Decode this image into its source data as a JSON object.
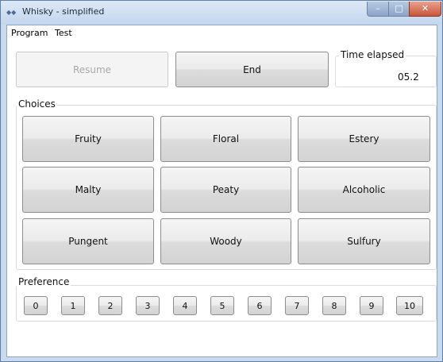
{
  "window": {
    "title": "Whisky - simplified",
    "icon": "app-icon"
  },
  "menu": {
    "items": [
      "Program",
      "Test"
    ]
  },
  "controls": {
    "resume_label": "Resume",
    "end_label": "End",
    "time_title": "Time elapsed",
    "time_value": "05.2"
  },
  "choices": {
    "label": "Choices",
    "buttons": [
      "Fruity",
      "Floral",
      "Estery",
      "Malty",
      "Peaty",
      "Alcoholic",
      "Pungent",
      "Woody",
      "Sulfury"
    ]
  },
  "preference": {
    "label": "Preference",
    "buttons": [
      "0",
      "1",
      "2",
      "3",
      "4",
      "5",
      "6",
      "7",
      "8",
      "9",
      "10"
    ]
  },
  "colors": {
    "window_frame": "#c9d9ee",
    "close_button": "#c9553a",
    "disabled_text": "#a8a8a8"
  }
}
